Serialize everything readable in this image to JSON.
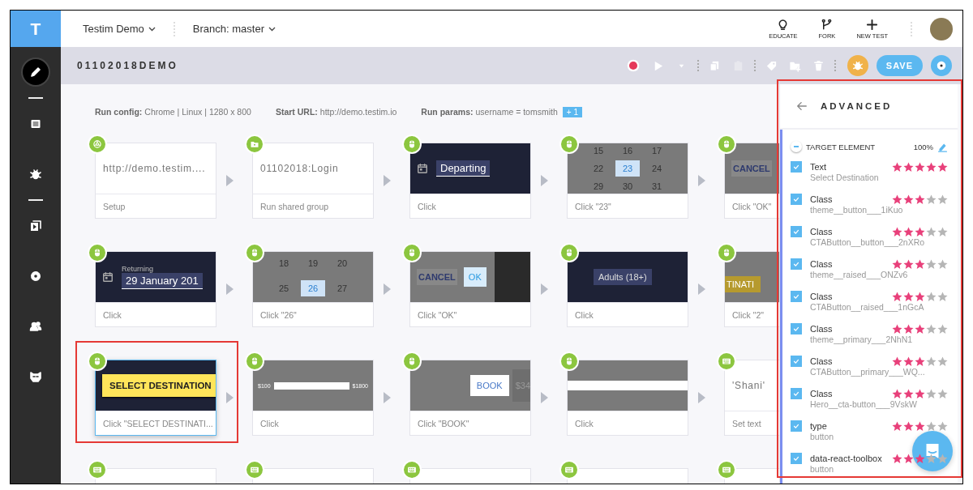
{
  "logo": "T",
  "header": {
    "project": "Testim Demo",
    "branch": "Branch: master",
    "actions": [
      {
        "kind": "bulb",
        "label": "EDUCATE"
      },
      {
        "kind": "fork",
        "label": "FORK"
      },
      {
        "kind": "plus",
        "label": "NEW TEST"
      }
    ]
  },
  "sidebar": {
    "groups": [
      [
        {
          "kind": "pencil",
          "selected": true
        }
      ],
      [
        {
          "kind": "list",
          "selected": false
        },
        {
          "kind": "bug",
          "selected": false
        }
      ],
      [
        {
          "kind": "play",
          "selected": false
        },
        {
          "kind": "gear",
          "selected": false
        },
        {
          "kind": "people",
          "selected": false
        },
        {
          "kind": "mask",
          "selected": false
        }
      ]
    ]
  },
  "test_title": "01102018DEMO",
  "toolbar": {
    "groups": [
      [
        {
          "kind": "record",
          "disabled": false
        },
        {
          "kind": "play",
          "disabled": false
        },
        {
          "kind": "caret",
          "disabled": false
        }
      ],
      [
        {
          "kind": "copy",
          "disabled": false
        },
        {
          "kind": "paste",
          "disabled": true
        }
      ],
      [
        {
          "kind": "tag",
          "disabled": false
        },
        {
          "kind": "folder-add",
          "disabled": false
        },
        {
          "kind": "trash",
          "disabled": false
        }
      ]
    ],
    "save": "SAVE"
  },
  "run_info": [
    {
      "label": "Run config:",
      "value": "Chrome | Linux | 1280 x 800"
    },
    {
      "label": "Start URL:",
      "value": "http://demo.testim.io"
    },
    {
      "label": "Run params:",
      "value": "username = tomsmith",
      "badge": "+ 1"
    }
  ],
  "steps": [
    {
      "kind": "browser",
      "thumb": {
        "kind": "text",
        "texts": [
          "http://demo.testim...."
        ]
      },
      "label": "Setup",
      "selected": false,
      "highlighted": false
    },
    {
      "kind": "folder",
      "thumb": {
        "kind": "text",
        "texts": [
          "01102018:Login"
        ]
      },
      "label": "Run shared group",
      "selected": false,
      "highlighted": false
    },
    {
      "kind": "mouse",
      "thumb": {
        "kind": "date-field",
        "texts": [
          "Departing"
        ]
      },
      "label": "Click",
      "selected": false,
      "highlighted": false
    },
    {
      "kind": "mouse",
      "thumb": {
        "kind": "calendar",
        "cells": [
          {
            "text": "15",
            "selected": false
          },
          {
            "text": "16",
            "selected": false
          },
          {
            "text": "17",
            "selected": false
          },
          {
            "text": "22",
            "selected": false
          },
          {
            "text": "23",
            "selected": true
          },
          {
            "text": "24",
            "selected": false
          },
          {
            "text": "29",
            "selected": false
          },
          {
            "text": "30",
            "selected": false
          },
          {
            "text": "31",
            "selected": false
          }
        ]
      },
      "label": "Click \"23\"",
      "selected": false,
      "highlighted": false
    },
    {
      "kind": "mouse",
      "thumb": {
        "kind": "dialog",
        "texts": [
          "CANCEL"
        ]
      },
      "label": "Click \"OK\"",
      "selected": false,
      "highlighted": false
    },
    {
      "kind": "mouse",
      "thumb": {
        "kind": "date-field",
        "texts": [
          "Returning",
          "29 January 201"
        ]
      },
      "label": "Click",
      "selected": false,
      "highlighted": false
    },
    {
      "kind": "mouse",
      "thumb": {
        "kind": "calendar",
        "cells": [
          {
            "text": "18",
            "selected": false
          },
          {
            "text": "19",
            "selected": false
          },
          {
            "text": "20",
            "selected": false
          },
          {
            "text": "25",
            "selected": false
          },
          {
            "text": "26",
            "selected": true
          },
          {
            "text": "27",
            "selected": false
          }
        ]
      },
      "label": "Click \"26\"",
      "selected": false,
      "highlighted": false
    },
    {
      "kind": "mouse",
      "thumb": {
        "kind": "dialog",
        "texts": [
          "CANCEL",
          "OK"
        ]
      },
      "label": "Click \"OK\"",
      "selected": false,
      "highlighted": false
    },
    {
      "kind": "mouse",
      "thumb": {
        "kind": "dropdown",
        "texts": [
          "Adults (18+)"
        ]
      },
      "label": "Click",
      "selected": false,
      "highlighted": false
    },
    {
      "kind": "mouse",
      "thumb": {
        "kind": "banner",
        "texts": [
          "TINATI"
        ]
      },
      "label": "Click \"2\"",
      "selected": false,
      "highlighted": false
    },
    {
      "kind": "mouse",
      "thumb": {
        "kind": "cta",
        "texts": [
          "SELECT DESTINATION"
        ]
      },
      "label": "Click \"SELECT DESTINATI...",
      "selected": true,
      "highlighted": true
    },
    {
      "kind": "mouse",
      "thumb": {
        "kind": "slider",
        "texts": [
          "$100",
          "$1800"
        ]
      },
      "label": "Click",
      "selected": false,
      "highlighted": false
    },
    {
      "kind": "mouse",
      "thumb": {
        "kind": "book",
        "texts": [
          "BOOK",
          "$34"
        ]
      },
      "label": "Click \"BOOK\"",
      "selected": false,
      "highlighted": false
    },
    {
      "kind": "mouse",
      "thumb": {
        "kind": "bar"
      },
      "label": "Click",
      "selected": false,
      "highlighted": false
    },
    {
      "kind": "keyboard",
      "thumb": {
        "kind": "text",
        "texts": [
          "'Shani'"
        ]
      },
      "label": "Set text",
      "selected": false,
      "highlighted": false
    },
    {
      "kind": "keyboard",
      "thumb": {
        "kind": "blank"
      },
      "selected": false,
      "highlighted": false
    },
    {
      "kind": "keyboard",
      "thumb": {
        "kind": "blank"
      },
      "selected": false,
      "highlighted": false
    },
    {
      "kind": "keyboard",
      "thumb": {
        "kind": "blank"
      },
      "selected": false,
      "highlighted": false
    },
    {
      "kind": "keyboard",
      "thumb": {
        "kind": "blank"
      },
      "selected": false,
      "highlighted": false
    },
    {
      "kind": "keyboard",
      "thumb": {
        "kind": "blank"
      },
      "selected": false,
      "highlighted": false
    }
  ],
  "panel": {
    "title": "ADVANCED",
    "highlighted": true,
    "target": {
      "label": "TARGET ELEMENT",
      "score": "100%"
    },
    "attributes": [
      {
        "name": "Text",
        "value": "Select Destination",
        "checked": true,
        "stars": 5
      },
      {
        "name": "Class",
        "value": "theme__button___1iKuo",
        "checked": true,
        "stars": 3
      },
      {
        "name": "Class",
        "value": "CTAButton__button___2nXRo",
        "checked": true,
        "stars": 3
      },
      {
        "name": "Class",
        "value": "theme__raised___ONZv6",
        "checked": true,
        "stars": 3
      },
      {
        "name": "Class",
        "value": "CTAButton__raised___1nGcA",
        "checked": true,
        "stars": 3
      },
      {
        "name": "Class",
        "value": "theme__primary___2NhN1",
        "checked": true,
        "stars": 3
      },
      {
        "name": "Class",
        "value": "CTAButton__primary___WQ...",
        "checked": true,
        "stars": 3
      },
      {
        "name": "Class",
        "value": "Hero__cta-button___9VskW",
        "checked": true,
        "stars": 3
      },
      {
        "name": "type",
        "value": "button",
        "checked": true,
        "stars": 3
      },
      {
        "name": "data-react-toolbox",
        "value": "button",
        "checked": true,
        "stars": 3
      }
    ]
  }
}
